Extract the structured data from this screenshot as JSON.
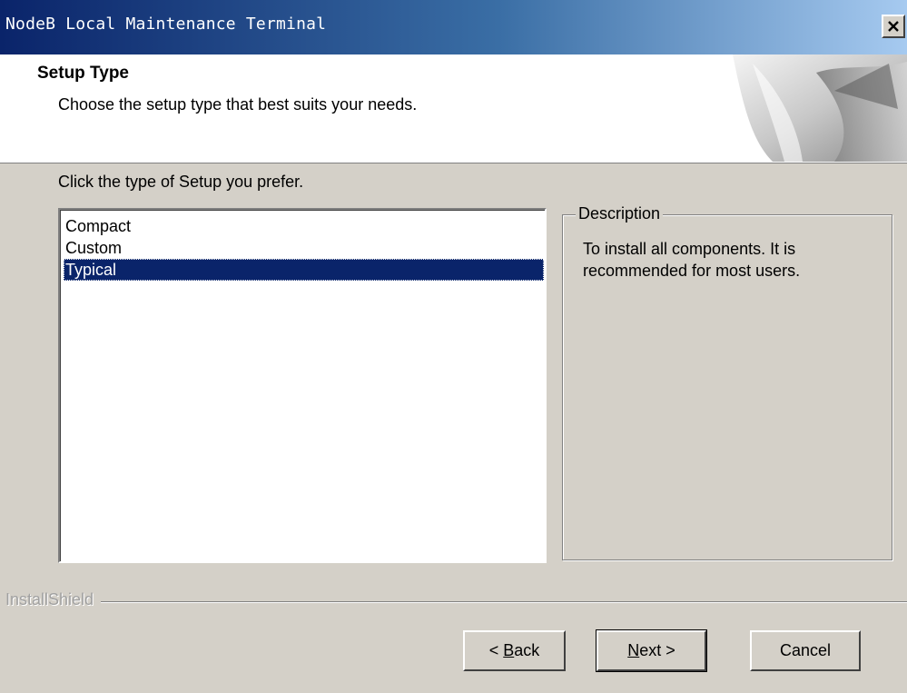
{
  "window": {
    "title": "NodeB Local Maintenance Terminal",
    "close_label": "×"
  },
  "header": {
    "title": "Setup Type",
    "subtitle": "Choose the setup type that best suits your needs."
  },
  "main": {
    "instruction": "Click the type of Setup you prefer.",
    "setup_types": [
      {
        "label": "Compact",
        "selected": false
      },
      {
        "label": "Custom",
        "selected": false
      },
      {
        "label": "Typical",
        "selected": true
      }
    ],
    "description": {
      "legend": "Description",
      "text": "To install all components. It is recommended for most users."
    }
  },
  "footer": {
    "brand": "InstallShield",
    "back": {
      "mnemonic": "B",
      "rest": "ack",
      "prefix": "< "
    },
    "next": {
      "mnemonic": "N",
      "rest": "ext >"
    },
    "cancel": "Cancel"
  },
  "colors": {
    "titlebar_start": "#0a246a",
    "titlebar_end": "#a6caf0",
    "dialog_face": "#d4d0c8",
    "selection": "#0a246a"
  }
}
